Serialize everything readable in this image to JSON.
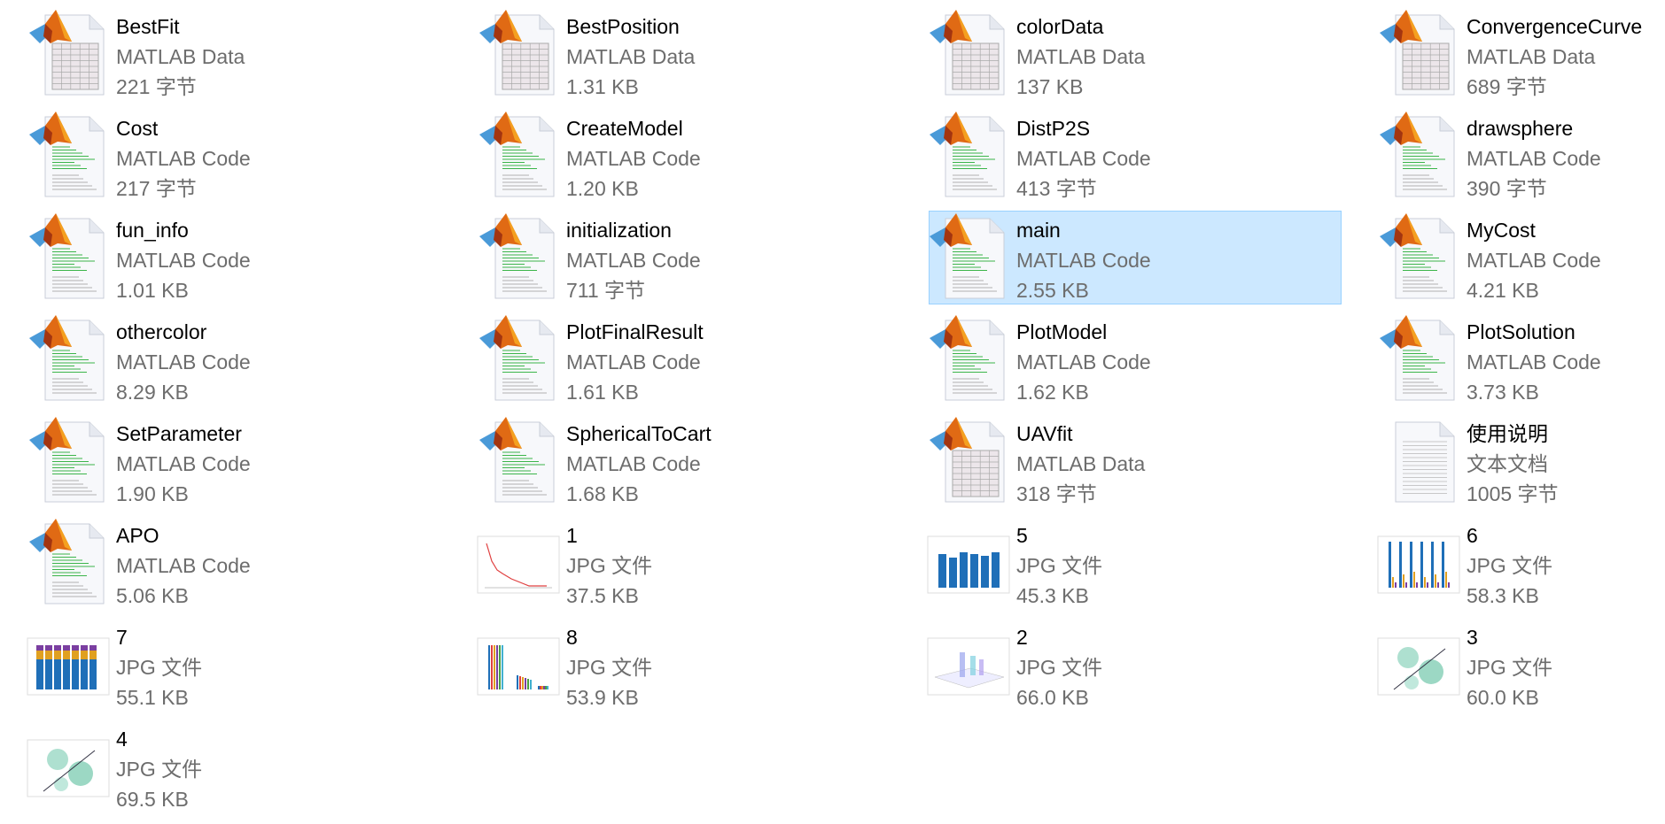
{
  "items": [
    {
      "name": "BestFit",
      "type": "MATLAB Data",
      "size": "221 字节",
      "icon": "matlab-data"
    },
    {
      "name": "BestPosition",
      "type": "MATLAB Data",
      "size": "1.31 KB",
      "icon": "matlab-data"
    },
    {
      "name": "colorData",
      "type": "MATLAB Data",
      "size": "137 KB",
      "icon": "matlab-data"
    },
    {
      "name": "ConvergenceCurve",
      "type": "MATLAB Data",
      "size": "689 字节",
      "icon": "matlab-data"
    },
    {
      "name": "Cost",
      "type": "MATLAB Code",
      "size": "217 字节",
      "icon": "matlab-code"
    },
    {
      "name": "CreateModel",
      "type": "MATLAB Code",
      "size": "1.20 KB",
      "icon": "matlab-code"
    },
    {
      "name": "DistP2S",
      "type": "MATLAB Code",
      "size": "413 字节",
      "icon": "matlab-code"
    },
    {
      "name": "drawsphere",
      "type": "MATLAB Code",
      "size": "390 字节",
      "icon": "matlab-code"
    },
    {
      "name": "fun_info",
      "type": "MATLAB Code",
      "size": "1.01 KB",
      "icon": "matlab-code"
    },
    {
      "name": "initialization",
      "type": "MATLAB Code",
      "size": "711 字节",
      "icon": "matlab-code"
    },
    {
      "name": "main",
      "type": "MATLAB Code",
      "size": "2.55 KB",
      "icon": "matlab-code",
      "selected": true
    },
    {
      "name": "MyCost",
      "type": "MATLAB Code",
      "size": "4.21 KB",
      "icon": "matlab-code"
    },
    {
      "name": "othercolor",
      "type": "MATLAB Code",
      "size": "8.29 KB",
      "icon": "matlab-code"
    },
    {
      "name": "PlotFinalResult",
      "type": "MATLAB Code",
      "size": "1.61 KB",
      "icon": "matlab-code"
    },
    {
      "name": "PlotModel",
      "type": "MATLAB Code",
      "size": "1.62 KB",
      "icon": "matlab-code"
    },
    {
      "name": "PlotSolution",
      "type": "MATLAB Code",
      "size": "3.73 KB",
      "icon": "matlab-code"
    },
    {
      "name": "SetParameter",
      "type": "MATLAB Code",
      "size": "1.90 KB",
      "icon": "matlab-code"
    },
    {
      "name": "SphericalToCart",
      "type": "MATLAB Code",
      "size": "1.68 KB",
      "icon": "matlab-code"
    },
    {
      "name": "UAVfit",
      "type": "MATLAB Data",
      "size": "318 字节",
      "icon": "matlab-data"
    },
    {
      "name": "使用说明",
      "type": "文本文档",
      "size": "1005 字节",
      "icon": "text-document"
    },
    {
      "name": "APO",
      "type": "MATLAB Code",
      "size": "5.06 KB",
      "icon": "matlab-code"
    },
    {
      "name": "1",
      "type": "JPG 文件",
      "size": "37.5 KB",
      "icon": "thumb-line"
    },
    {
      "name": "5",
      "type": "JPG 文件",
      "size": "45.3 KB",
      "icon": "thumb-bar"
    },
    {
      "name": "6",
      "type": "JPG 文件",
      "size": "58.3 KB",
      "icon": "thumb-grouped"
    },
    {
      "name": "7",
      "type": "JPG 文件",
      "size": "55.1 KB",
      "icon": "thumb-stacked"
    },
    {
      "name": "8",
      "type": "JPG 文件",
      "size": "53.9 KB",
      "icon": "thumb-grouped2"
    },
    {
      "name": "2",
      "type": "JPG 文件",
      "size": "66.0 KB",
      "icon": "thumb-3d"
    },
    {
      "name": "3",
      "type": "JPG 文件",
      "size": "60.0 KB",
      "icon": "thumb-heat"
    },
    {
      "name": "4",
      "type": "JPG 文件",
      "size": "69.5 KB",
      "icon": "thumb-heat"
    }
  ],
  "colors": {
    "selection": "#cce8ff",
    "selection_border": "#99d1ff"
  }
}
